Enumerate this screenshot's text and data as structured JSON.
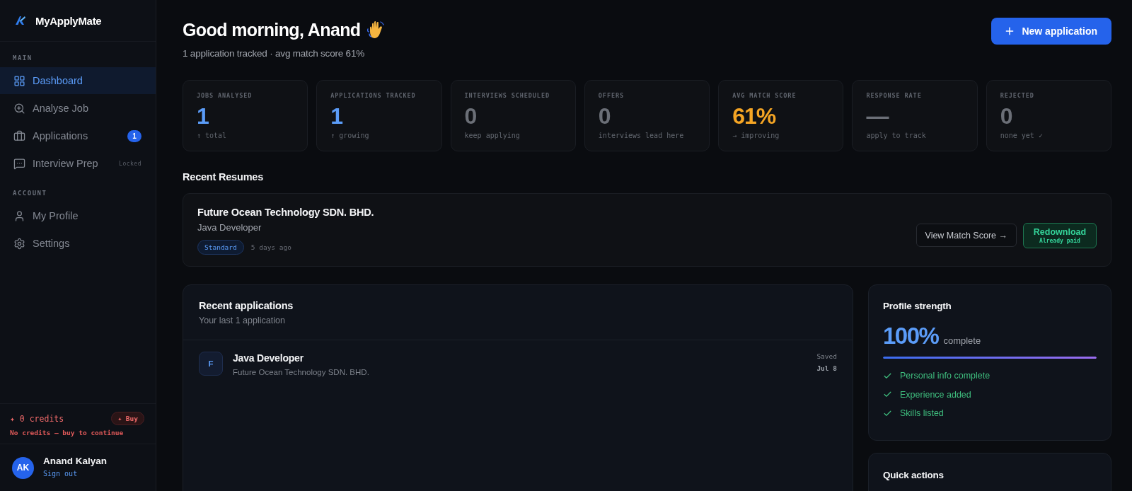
{
  "sidebar": {
    "brand": "MyApplyMate",
    "sections": [
      {
        "label": "MAIN",
        "items": [
          {
            "label": "Dashboard",
            "selected": true
          },
          {
            "label": "Analyse Job",
            "selected": false
          },
          {
            "label": "Applications",
            "selected": false,
            "badge": "1"
          },
          {
            "label": "Interview Prep",
            "selected": false,
            "tag": "Locked"
          }
        ]
      },
      {
        "label": "ACCOUNT",
        "items": [
          {
            "label": "My Profile",
            "selected": false
          },
          {
            "label": "Settings",
            "selected": false
          }
        ]
      }
    ],
    "credits": {
      "count": "✦ 0 credits",
      "buy": "✦ Buy",
      "message": "No credits — buy to continue"
    },
    "user": {
      "initials": "AK",
      "name": "Anand Kalyan",
      "sign_out": "Sign out"
    }
  },
  "header": {
    "title": "Good morning, Anand",
    "subtitle": "1 application tracked · avg match score 61%",
    "button": "New application"
  },
  "stats": [
    {
      "label": "JOBS ANALYSED",
      "value": "1",
      "note": "↑ total",
      "color": "#5b9cf8"
    },
    {
      "label": "APPLICATIONS TRACKED",
      "value": "1",
      "note": "↑ growing",
      "color": "#5b9cf8"
    },
    {
      "label": "INTERVIEWS SCHEDULED",
      "value": "0",
      "note": "keep applying",
      "color": "#6b6f77"
    },
    {
      "label": "OFFERS",
      "value": "0",
      "note": "interviews lead here",
      "color": "#6b6f77"
    },
    {
      "label": "AVG MATCH SCORE",
      "value": "61%",
      "note": "→ improving",
      "color": "#f5a524"
    },
    {
      "label": "RESPONSE RATE",
      "value": "—",
      "note": "apply to track",
      "color": "#6b6f77"
    },
    {
      "label": "REJECTED",
      "value": "0",
      "note": "none yet ✓",
      "color": "#6b6f77"
    }
  ],
  "recent_resumes": {
    "title": "Recent Resumes",
    "items": [
      {
        "company": "Future Ocean Technology SDN. BHD.",
        "role": "Java Developer",
        "badge": "Standard",
        "time": "5 days ago",
        "view_button": "View Match Score →",
        "redownload_button": {
          "label": "Redownload",
          "note": "Already paid"
        }
      }
    ]
  },
  "recent_applications": {
    "title": "Recent applications",
    "subtitle": "Your last 1 application",
    "rows": [
      {
        "initial": "F",
        "title": "Java Developer",
        "company": "Future Ocean Technology SDN. BHD.",
        "status": "Saved",
        "date": "Jul 8"
      }
    ]
  },
  "profile_strength": {
    "title": "Profile strength",
    "value": "100%",
    "suffix": "complete",
    "level": 1.0,
    "checks": [
      {
        "label": "Personal info complete",
        "checked": true
      },
      {
        "label": "Experience added",
        "checked": true
      },
      {
        "label": "Skills listed",
        "checked": true
      }
    ]
  },
  "quick_actions": {
    "title": "Quick actions"
  }
}
